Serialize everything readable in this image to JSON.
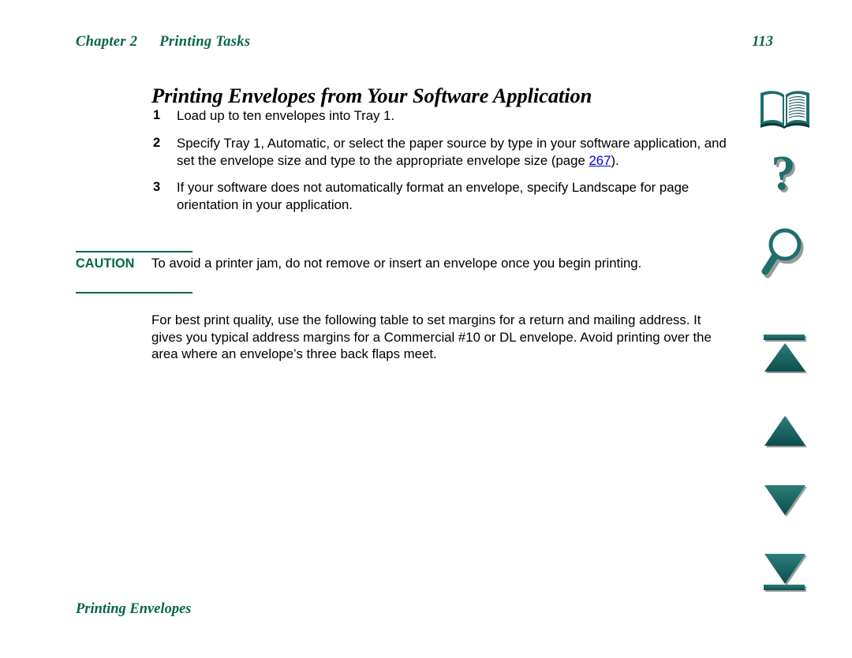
{
  "page": {
    "background": "#ffffff",
    "accent_green": "#056646",
    "icon_teal": "#1f6e6c",
    "link_blue": "#0000e0"
  },
  "running_head": {
    "chapter_label": "Chapter 2",
    "chapter_title": "Printing Tasks",
    "page_number": "113"
  },
  "section": {
    "title": "Printing Envelopes from Your Software Application"
  },
  "steps": [
    {
      "number": "1",
      "text": "Load up to ten envelopes into Tray 1."
    },
    {
      "number": "2",
      "text_before_link": "Specify Tray 1, Automatic, or select the paper source by type in your software application, and set the envelope size and type to the appropriate envelope size (page ",
      "link_text": "267",
      "text_after_link": ")."
    },
    {
      "number": "3",
      "text": "If your software does not automatically format an envelope, specify Landscape for page orientation in your application."
    }
  ],
  "caution": {
    "label": "CAUTION",
    "text": "To avoid a printer jam, do not remove or insert an envelope once you begin printing."
  },
  "body_paragraph": "For best print quality, use the following table to set margins for a return and mailing address. It gives you typical address margins for a Commercial #10 or DL envelope. Avoid printing over the area where an envelope’s three back flaps meet.",
  "footer": {
    "text": "Printing Envelopes"
  },
  "nav_icons": [
    {
      "name": "open-book-icon",
      "label": "Table of contents"
    },
    {
      "name": "question-mark-icon",
      "label": "Help"
    },
    {
      "name": "magnifier-icon",
      "label": "Search"
    },
    {
      "name": "first-page-icon",
      "label": "First page"
    },
    {
      "name": "previous-page-icon",
      "label": "Previous page"
    },
    {
      "name": "next-page-icon",
      "label": "Next page"
    },
    {
      "name": "last-page-icon",
      "label": "Last page"
    }
  ]
}
